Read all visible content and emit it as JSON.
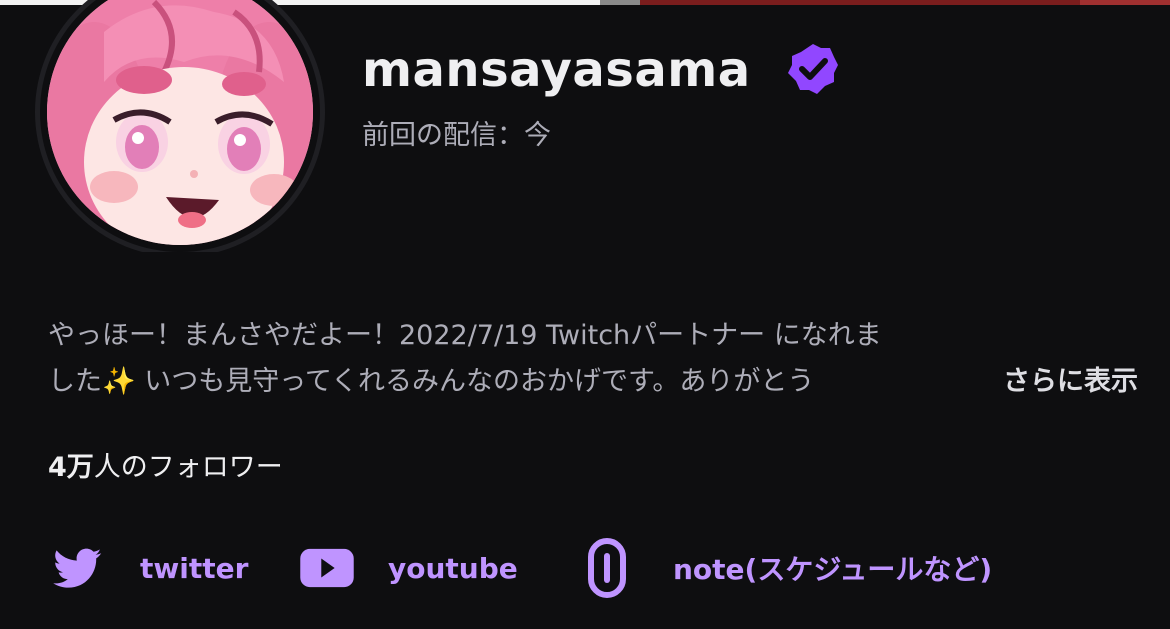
{
  "channel": {
    "username": "mansayasama",
    "last_stream": "前回の配信：今",
    "verified_icon": "verified-badge-icon",
    "accent_color": "#bf94ff",
    "verified_color": "#9147ff"
  },
  "bio": {
    "line1": "やっほー！まんさやだよー！2022/7/19 Twitchパートナー になれま",
    "line2": "した✨ いつも見守ってくれるみんなのおかげです。ありがとう",
    "show_more": "さらに表示"
  },
  "followers": {
    "count": "4万",
    "suffix": "人のフォロワー"
  },
  "links": [
    {
      "label": "twitter",
      "icon": "twitter-icon"
    },
    {
      "label": "youtube",
      "icon": "youtube-icon"
    },
    {
      "label": "note(スケジュールなど)",
      "icon": "link-icon"
    }
  ]
}
